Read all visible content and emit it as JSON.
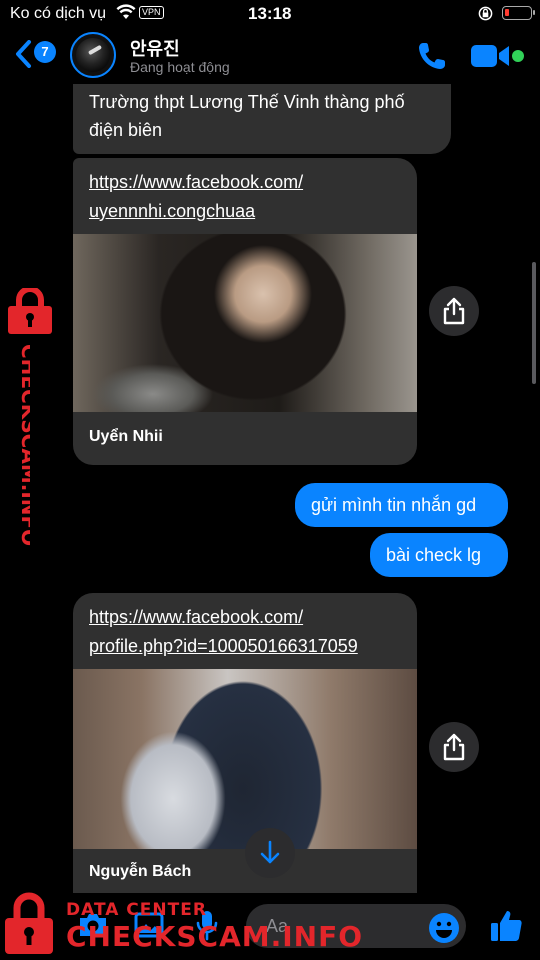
{
  "status_bar": {
    "carrier": "Ko có dịch vụ",
    "vpn": "VPN",
    "time": "13:18"
  },
  "header": {
    "back_badge": "7",
    "name": "안유진",
    "status": "Đang hoạt động"
  },
  "messages": [
    {
      "direction": "incoming",
      "text": "Trường thpt Lương Thế Vinh thàng phố điện biên"
    },
    {
      "direction": "incoming",
      "type": "link",
      "url_line1": "https://www.facebook.com/",
      "url_line2": "uyennnhi.congchuaa",
      "title": "Uyển Nhii"
    },
    {
      "direction": "outgoing",
      "text": "gửi mình tin nhắn gd"
    },
    {
      "direction": "outgoing",
      "text": "bài check lg"
    },
    {
      "direction": "incoming",
      "type": "link",
      "url_line1": "https://www.facebook.com/",
      "url_line2": "profile.php?id=100050166317059",
      "title": "Nguyễn Bách"
    }
  ],
  "composer": {
    "placeholder": "Aa"
  },
  "watermark": {
    "small": "DATA CENTER",
    "large": "CHECKSCAM.INFO"
  },
  "colors": {
    "accent": "#0a84ff",
    "incoming_bubble": "#303030",
    "watermark": "#e3262b",
    "online": "#31d158"
  },
  "icons": [
    "wifi-icon",
    "lock-rotation-icon",
    "battery-icon",
    "back-chevron-icon",
    "phone-icon",
    "video-icon",
    "share-icon",
    "arrow-down-icon",
    "camera-icon",
    "image-icon",
    "mic-icon",
    "emoji-icon",
    "thumbs-up-icon",
    "padlock-icon"
  ]
}
